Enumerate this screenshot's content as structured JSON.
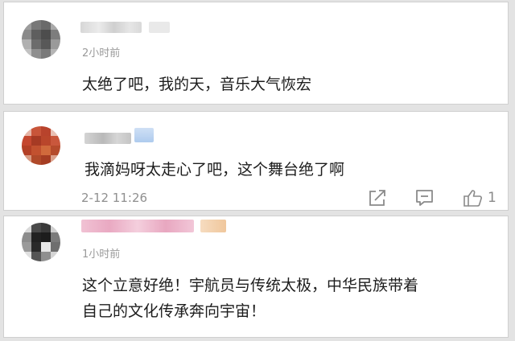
{
  "comments": [
    {
      "time": "2小时前",
      "text": "太绝了吧，我的天，音乐大气恢宏"
    },
    {
      "text": "我滴妈呀太走心了吧，这个舞台绝了啊",
      "time": "2-12 11:26",
      "actions": {
        "share_icon": "share-icon",
        "reply_icon": "comment-icon",
        "like_icon": "thumbs-up-icon",
        "like_count": "1"
      }
    },
    {
      "time": "1小时前",
      "text_lines": [
        "这个立意好绝！宇航员与传统太极，中华民族带着",
        "自己的文化传承奔向宇宙！"
      ]
    }
  ],
  "colors": {
    "background": "#e3e3e3",
    "card": "#ffffff",
    "text": "#1d1d1d",
    "meta": "#9a9a9a"
  }
}
